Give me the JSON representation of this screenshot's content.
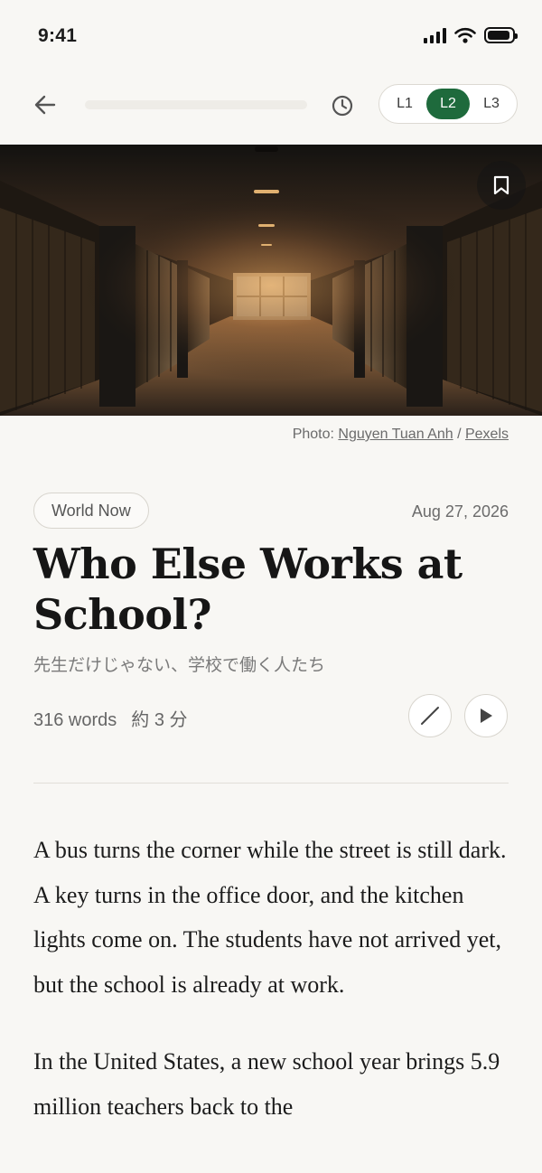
{
  "status": {
    "time": "9:41"
  },
  "nav": {
    "reading_progress_percent": 0,
    "levels": [
      "L1",
      "L2",
      "L3"
    ],
    "active_level": "L2"
  },
  "photo_credit": {
    "prefix": "Photo: ",
    "author": "Nguyen Tuan Anh",
    "separator": " / ",
    "source": "Pexels"
  },
  "article": {
    "category": "World Now",
    "date": "Aug 27, 2026",
    "title": "Who Else Works at School?",
    "subtitle": "先生だけじゃない、学校で働く人たち",
    "word_count": "316 words",
    "reading_time": "約 3 分",
    "paragraphs": [
      "A bus turns the corner while the street is still dark. A key turns in the office door, and the kitchen lights come on. The students have not arrived yet, but the school is already at work.",
      "In the United States, a new school year brings 5.9 million teachers back to the"
    ]
  },
  "colors": {
    "accent": "#1e6a3c",
    "background": "#f8f7f4"
  }
}
